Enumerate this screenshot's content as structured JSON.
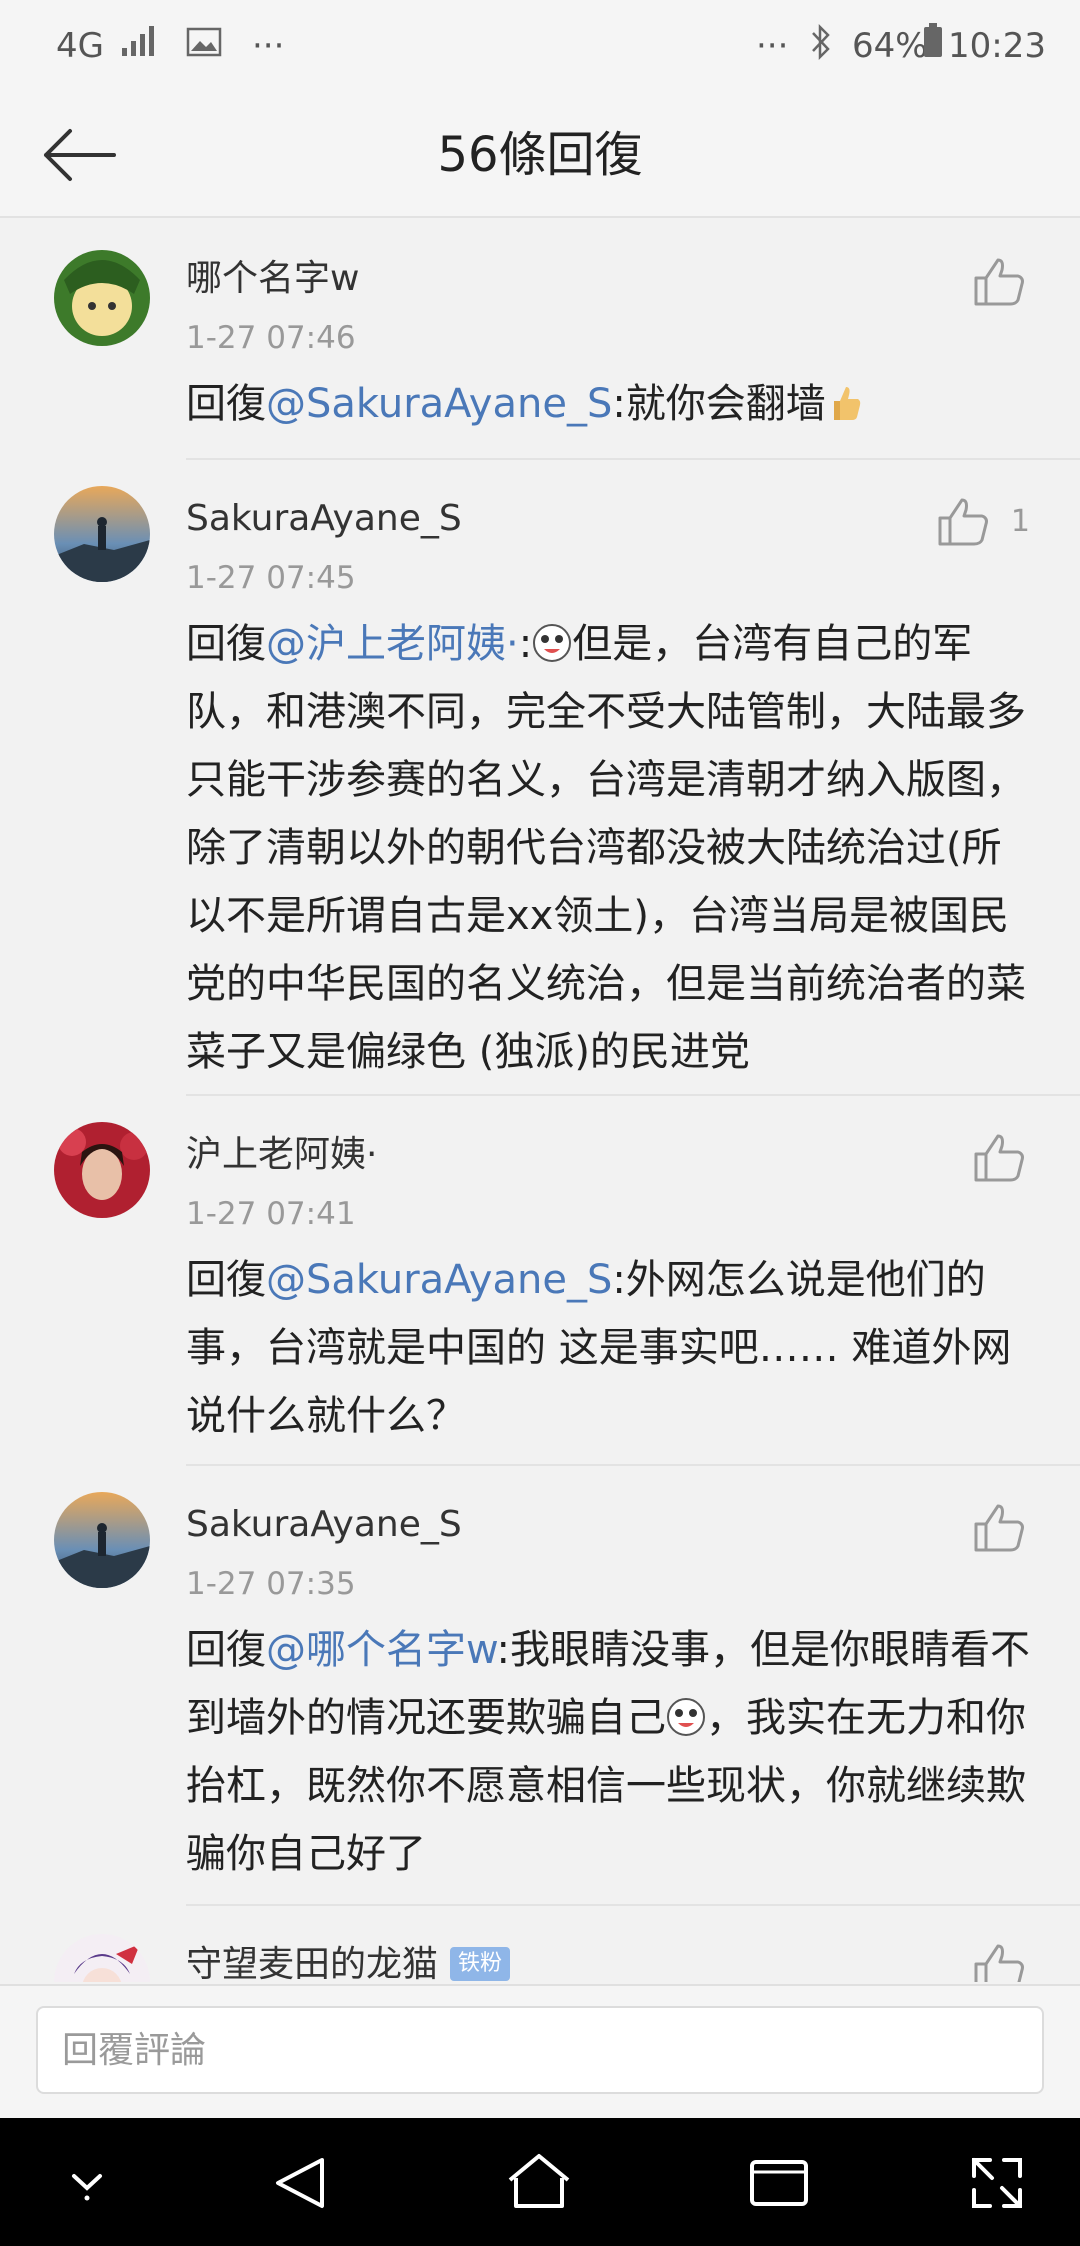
{
  "status_bar": {
    "network": "4G",
    "signal_icon": "signal-bars-icon",
    "image_icon": "image-notification-icon",
    "dots_left": "···",
    "dots_right": "···",
    "bluetooth_icon": "bluetooth-icon",
    "battery": "64%",
    "time": "10:23"
  },
  "header": {
    "back_icon": "arrow-left-icon",
    "title": "56條回復"
  },
  "comments": [
    {
      "name": "哪个名字w",
      "time": "1-27 07:46",
      "reply_prefix": "回復",
      "mention": "@SakuraAyane_S",
      "text": ":就你会翻墙",
      "emoji": "thumbs-up-emoji",
      "like_count": ""
    },
    {
      "name": "SakuraAyane_S",
      "time": "1-27 07:45",
      "reply_prefix": "回復",
      "mention": "@沪上老阿姨·",
      "text_a": ":",
      "emoji": "laughing-face-emoji",
      "text_b": "但是，台湾有自己的军队，和港澳不同，完全不受大陆管制，大陆最多只能干涉参赛的名义，台湾是清朝才纳入版图，除了清朝以外的朝代台湾都没被大陆统治过(所以不是所谓自古是xx领土)，台湾当局是被国民党的中华民国的名义统治，但是当前统治者的菜菜子又是偏绿色 (独派)的民进党",
      "like_count": "1"
    },
    {
      "name": "沪上老阿姨·",
      "time": "1-27 07:41",
      "reply_prefix": "回復",
      "mention": "@SakuraAyane_S",
      "text": ":外网怎么说是他们的事，台湾就是中国的 这是事实吧…… 难道外网说什么就什么？",
      "like_count": ""
    },
    {
      "name": "SakuraAyane_S",
      "time": "1-27 07:35",
      "reply_prefix": "回復",
      "mention": "@哪个名字w",
      "text_a": ":我眼睛没事，但是你眼睛看不到墙外的情况还要欺骗自己",
      "emoji": "laughing-face-emoji",
      "text_b": "，我实在无力和你抬杠，既然你不愿意相信一些现状，你就继续欺骗你自己好了",
      "like_count": ""
    },
    {
      "name": "守望麦田的龙猫",
      "badge": "铁粉",
      "like_count": ""
    }
  ],
  "input": {
    "placeholder": "回覆評論"
  },
  "nav_bar": {
    "items": [
      "chevron-down-icon",
      "back-triangle-icon",
      "home-icon",
      "recents-icon",
      "expand-icon"
    ]
  },
  "colors": {
    "mention": "#4a78b8",
    "background": "#f2f2f2",
    "badge": "#8fb6e8"
  }
}
